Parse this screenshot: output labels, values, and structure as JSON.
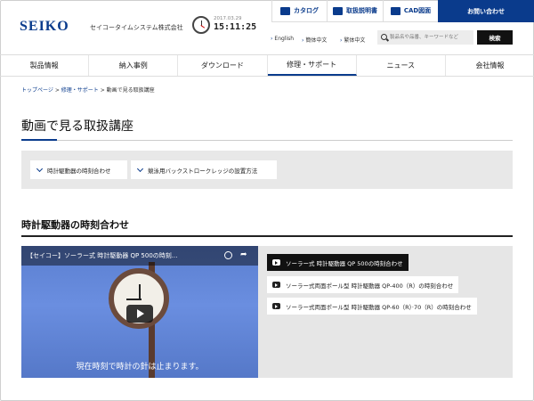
{
  "header": {
    "logo": "SEIKO",
    "company": "セイコータイムシステム株式会社",
    "date": "2017.03.29",
    "time": "15:11:25",
    "top_buttons": [
      "カタログ",
      "取扱説明書",
      "CAD図面",
      "お問い合わせ"
    ],
    "languages": [
      "English",
      "簡体中文",
      "繁体中文"
    ],
    "search_placeholder": "製品名や品番、キーワードなど",
    "search_button": "検索"
  },
  "nav": {
    "items": [
      "製品情報",
      "納入事例",
      "ダウンロード",
      "修理・サポート",
      "ニュース",
      "会社情報"
    ],
    "active_index": 3
  },
  "breadcrumb": {
    "home": "トップページ",
    "sep": ">",
    "support": "修理・サポート",
    "current": "動画で見る取扱講座"
  },
  "page": {
    "title": "動画で見る取扱講座",
    "anchors": [
      "時計駆動器の時刻合わせ",
      "競泳用バックストロークレッジの設置方法"
    ],
    "section_title": "時計駆動器の時刻合わせ"
  },
  "video": {
    "title": "【セイコー】ソーラー式 時計駆動器 QP 500の時刻...",
    "subtitle": "現在時刻で時計の針は止まります。",
    "links": [
      "ソーラー式 時計駆動器 QP 500の時刻合わせ",
      "ソーラー式両面ポール型 時計駆動器 QP-400（R）の時刻合わせ",
      "ソーラー式両面ポール型 時計駆動器 QP-60（R）·70（R）の時刻合わせ"
    ],
    "active_link_index": 0
  },
  "colors": {
    "brand": "#0a3b8c"
  }
}
